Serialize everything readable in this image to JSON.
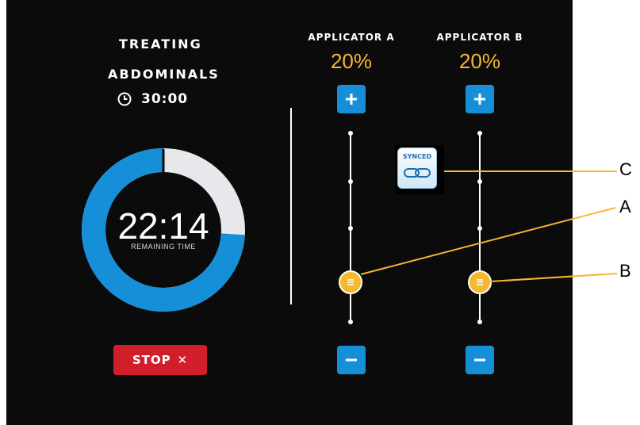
{
  "treatment": {
    "line1": "TREATING",
    "line2": "ABDOMINALS",
    "duration": "30:00",
    "remaining_time": "22:14",
    "remaining_label": "REMAINING TIME",
    "progress_fraction_remaining": 0.74,
    "stop_label": "STOP",
    "stop_icon": "✕"
  },
  "applicators": [
    {
      "title": "APPLICATOR A",
      "percent": "20%",
      "plus_icon": "+",
      "minus_icon": "−"
    },
    {
      "title": "APPLICATOR B",
      "percent": "20%",
      "plus_icon": "+",
      "minus_icon": "−"
    }
  ],
  "sync": {
    "label": "SYNCED",
    "icon": "link-icon"
  },
  "callouts": {
    "a": "A",
    "b": "B",
    "c": "C"
  },
  "colors": {
    "accent_blue": "#1590d8",
    "amber": "#f5b82e",
    "stop_red": "#d01f2b",
    "track_gray": "#e8e8ec"
  }
}
